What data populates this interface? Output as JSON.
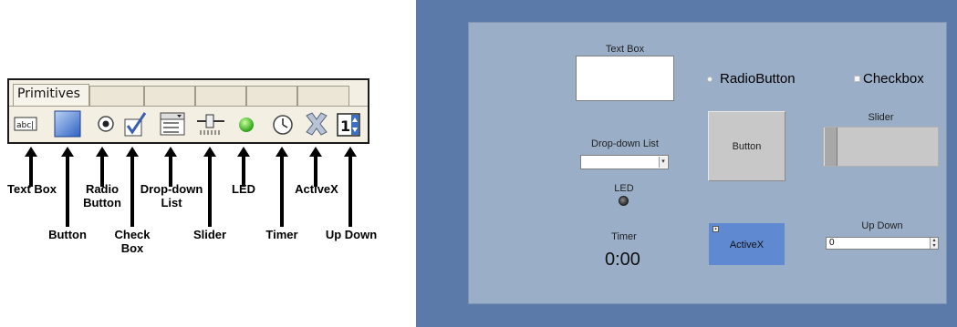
{
  "toolbar": {
    "active_tab": "Primitives",
    "tools": [
      {
        "icon": "text-box-icon",
        "glyph": "abc|"
      },
      {
        "icon": "button-icon"
      },
      {
        "icon": "radio-button-icon"
      },
      {
        "icon": "check-box-icon"
      },
      {
        "icon": "drop-down-list-icon",
        "glyph": "aed"
      },
      {
        "icon": "slider-icon"
      },
      {
        "icon": "led-icon"
      },
      {
        "icon": "timer-icon"
      },
      {
        "icon": "activex-icon"
      },
      {
        "icon": "up-down-icon",
        "glyph": "1"
      }
    ]
  },
  "labels": {
    "text_box": "Text Box",
    "button": "Button",
    "radio_button_1": "Radio",
    "radio_button_2": "Button",
    "check_box_1": "Check",
    "check_box_2": "Box",
    "drop_down_1": "Drop-down",
    "drop_down_2": "List",
    "slider": "Slider",
    "led": "LED",
    "timer": "Timer",
    "activex": "ActiveX",
    "up_down": "Up Down"
  },
  "form": {
    "text_box_caption": "Text Box",
    "radio_label": "RadioButton",
    "checkbox_label": "Checkbox",
    "slider_caption": "Slider",
    "slider_value": 0,
    "button_label": "Button",
    "dropdown_caption": "Drop-down List",
    "dropdown_value": "",
    "led_caption": "LED",
    "led_on": false,
    "timer_caption": "Timer",
    "timer_value": "0:00",
    "activex_label": "ActiveX",
    "updown_caption": "Up Down",
    "updown_value": "0"
  },
  "colors": {
    "frame": "#5b7aaa",
    "panel": "#9aaec8",
    "activex_fill": "#5f8ad2",
    "toolbar_bg": "#f3efe2"
  }
}
